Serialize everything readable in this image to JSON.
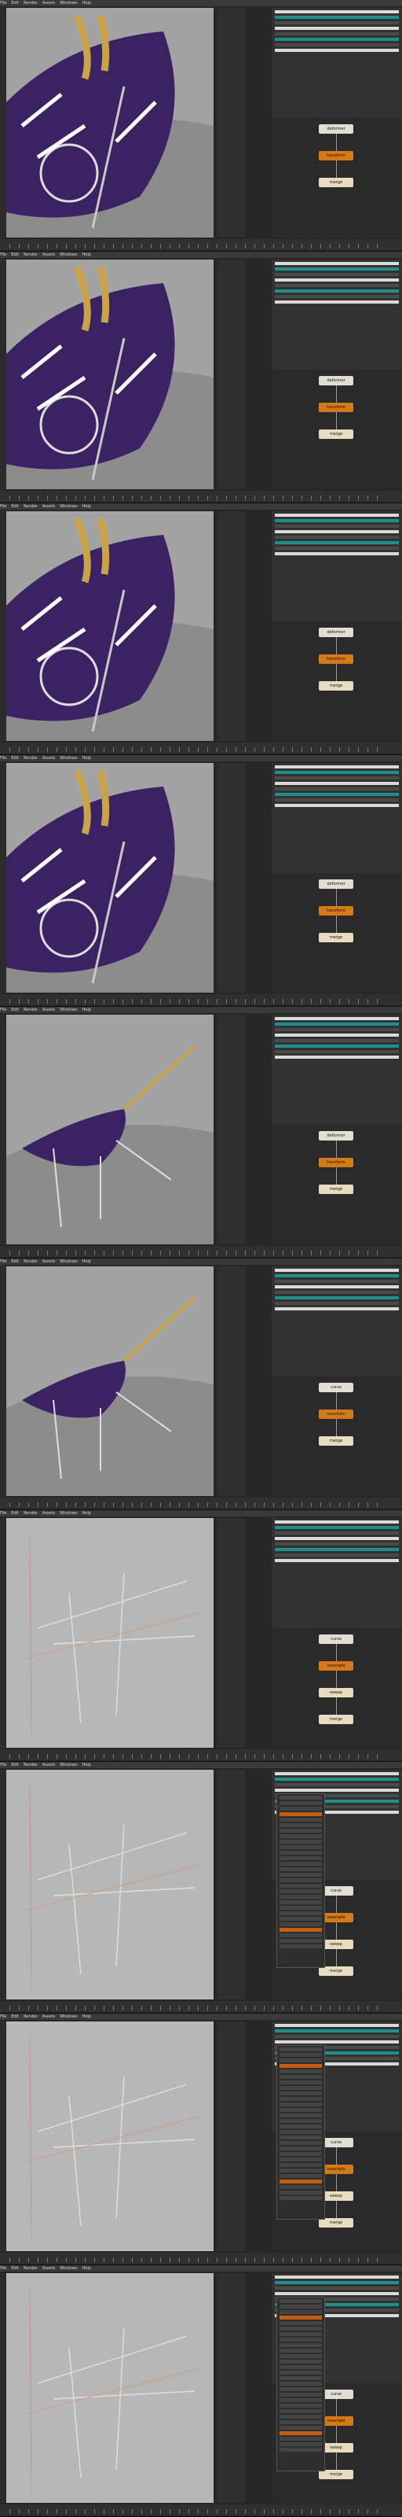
{
  "frames": [
    {
      "menu": [
        "File",
        "Edit",
        "Render",
        "Assets",
        "Windows",
        "Help"
      ],
      "nodes": [
        "deformer",
        "transform",
        "merge"
      ]
    },
    {
      "menu": [
        "File",
        "Edit",
        "Render",
        "Assets",
        "Windows",
        "Help"
      ],
      "nodes": [
        "deformer",
        "transform",
        "merge"
      ]
    },
    {
      "menu": [
        "File",
        "Edit",
        "Render",
        "Assets",
        "Windows",
        "Help"
      ],
      "nodes": [
        "deformer",
        "transform",
        "merge"
      ]
    },
    {
      "menu": [
        "File",
        "Edit",
        "Render",
        "Assets",
        "Windows",
        "Help"
      ],
      "nodes": [
        "deformer",
        "transform",
        "merge"
      ]
    },
    {
      "menu": [
        "File",
        "Edit",
        "Render",
        "Assets",
        "Windows",
        "Help"
      ],
      "nodes": [
        "deformer",
        "transform",
        "merge"
      ]
    },
    {
      "menu": [
        "File",
        "Edit",
        "Render",
        "Assets",
        "Windows",
        "Help"
      ],
      "nodes": [
        "curve",
        "mountain",
        "merge"
      ]
    },
    {
      "menu": [
        "File",
        "Edit",
        "Render",
        "Assets",
        "Windows",
        "Help"
      ],
      "nodes": [
        "curve",
        "resample",
        "sweep",
        "merge"
      ]
    },
    {
      "menu": [
        "File",
        "Edit",
        "Render",
        "Assets",
        "Windows",
        "Help"
      ],
      "nodes": [
        "curve",
        "resample",
        "sweep",
        "merge"
      ]
    },
    {
      "menu": [
        "File",
        "Edit",
        "Render",
        "Assets",
        "Windows",
        "Help"
      ],
      "nodes": [
        "curve",
        "resample",
        "sweep",
        "merge"
      ]
    },
    {
      "menu": [
        "File",
        "Edit",
        "Render",
        "Assets",
        "Windows",
        "Help"
      ],
      "nodes": [
        "curve",
        "resample",
        "sweep",
        "merge"
      ]
    }
  ],
  "colors": {
    "hull": "#3b2363",
    "gold": "#c9a24a",
    "ground": "#8e8e8e",
    "node_orange": "#d47a18",
    "teal": "#1f8f8f"
  }
}
